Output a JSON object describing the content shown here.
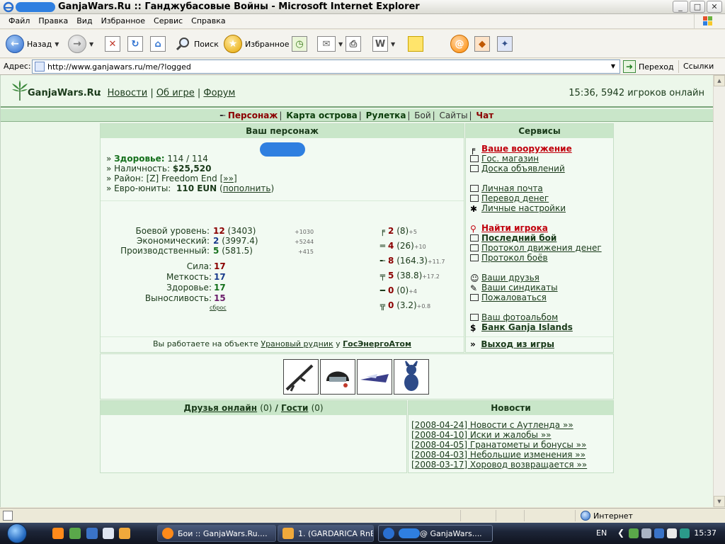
{
  "window": {
    "title": "GanjaWars.Ru :: Ганджубасовые Войны - Microsoft Internet Explorer",
    "min_icon": "minimize-icon",
    "max_icon": "maximize-icon",
    "close_icon": "close-icon"
  },
  "menu": {
    "items": [
      "Файл",
      "Правка",
      "Вид",
      "Избранное",
      "Сервис",
      "Справка"
    ]
  },
  "toolbar": {
    "back": "Назад",
    "search": "Поиск",
    "favorites": "Избранное"
  },
  "address": {
    "label": "Адрес:",
    "url": "http://www.ganjawars.ru/me/?logged",
    "go": "Переход",
    "links": "Ссылки"
  },
  "site": {
    "title": "GanjaWars.Ru",
    "nav_sep": ":",
    "nav": [
      "Новости",
      "Об игре",
      "Форум"
    ],
    "online": "15:36, 5942 игроков онлайн"
  },
  "gamenav": {
    "items": [
      "Персонаж",
      "Карта острова",
      "Рулетка",
      "Бой",
      "Сайты",
      "Чат"
    ]
  },
  "character": {
    "header": "Ваш персонаж",
    "health_label": "Здоровье:",
    "health": "114 / 114",
    "cash_label": "Наличность:",
    "cash": "$25,520",
    "district_label": "Район:",
    "district": "[Z] Freedom End",
    "district_link": "[»»]",
    "euro_label": "Евро-юниты:",
    "euro": "110 EUN",
    "euro_link": "пополнить",
    "levels": [
      {
        "label": "Боевой уровень:",
        "value": "12",
        "extra": "(3403)",
        "bonus": "+1030"
      },
      {
        "label": "Экономический:",
        "value": "2",
        "extra": "(3997.4)",
        "bonus": "+5244"
      },
      {
        "label": "Производственный:",
        "value": "5",
        "extra": "(581.5)",
        "bonus": "+415"
      }
    ],
    "stats": [
      {
        "label": "Сила:",
        "value": "17"
      },
      {
        "label": "Меткость:",
        "value": "17"
      },
      {
        "label": "Здоровье:",
        "value": "17"
      },
      {
        "label": "Выносливость:",
        "value": "15"
      }
    ],
    "reset_link": "сброс",
    "weapons": [
      {
        "value": "2",
        "extra": "(8)",
        "bonus": "+5"
      },
      {
        "value": "4",
        "extra": "(26)",
        "bonus": "+10"
      },
      {
        "value": "8",
        "extra": "(164.3)",
        "bonus": "+11.7"
      },
      {
        "value": "5",
        "extra": "(38.8)",
        "bonus": "+17.2"
      },
      {
        "value": "0",
        "extra": "(0)",
        "bonus": "+4"
      },
      {
        "value": "0",
        "extra": "(3.2)",
        "bonus": "+0.8"
      }
    ],
    "work_prefix": "Вы работаете на объекте",
    "work_object": "Урановый рудник",
    "work_mid": "у",
    "work_company": "ГосЭнергоАтом"
  },
  "services": {
    "header": "Сервисы",
    "items": [
      "Ваше вооружение",
      "Гос. магазин",
      "Доска объявлений",
      "Личная почта",
      "Перевод денег",
      "Личные настройки",
      "Найти игрока",
      "Последний бой",
      "Протокол движения денег",
      "Протокол боёв",
      "Ваши друзья",
      "Ваши синдикаты",
      "Пожаловаться",
      "Ваш фотоальбом",
      "Банк Ganja Islands"
    ],
    "exit_prefix": "»",
    "exit": "Выход из игры"
  },
  "friends": {
    "label": "Друзья онлайн",
    "count": "(0)",
    "sep": "/",
    "guests": "Гости",
    "guests_count": "(0)"
  },
  "news": {
    "header": "Новости",
    "items": [
      "[2008-04-24] Новости с Аутленда »»",
      "[2008-04-10] Иски и жалобы »»",
      "[2008-04-05] Гранатометы и бонусы »»",
      "[2008-04-03] Небольшие изменения »»",
      "[2008-03-17] Хоровод возвращается »»"
    ]
  },
  "statusbar": {
    "zone": "Интернет"
  },
  "taskbar": {
    "tasks": [
      "Бои :: GanjaWars.Ru....",
      "1.  (GARDARICA RnB...",
      "@ GanjaWars...."
    ],
    "lang": "EN",
    "time": "15:37"
  },
  "colors": {
    "page_bg": "#ecf7ea",
    "header_green": "#c9e6c9",
    "link_dark": "#1a3a1a",
    "accent_red": "#8b0000",
    "accent_green": "#15701c"
  }
}
